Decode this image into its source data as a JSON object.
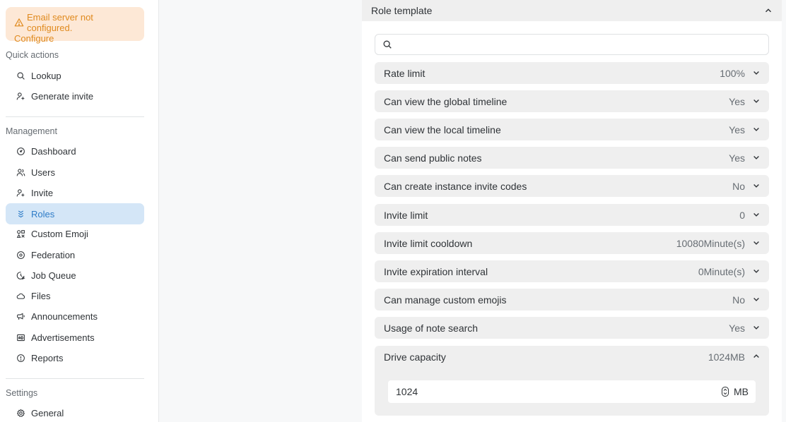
{
  "alert": {
    "message": "Email server not configured.",
    "link": "Configure"
  },
  "sidebar": {
    "quick_actions_title": "Quick actions",
    "quick_actions": [
      {
        "label": "Lookup",
        "icon": "search-icon"
      },
      {
        "label": "Generate invite",
        "icon": "user-plus-icon"
      }
    ],
    "management_title": "Management",
    "management": [
      {
        "label": "Dashboard",
        "icon": "gauge-icon"
      },
      {
        "label": "Users",
        "icon": "users-icon"
      },
      {
        "label": "Invite",
        "icon": "user-plus-icon"
      },
      {
        "label": "Roles",
        "icon": "badges-icon",
        "active": true
      },
      {
        "label": "Custom Emoji",
        "icon": "icons-icon"
      },
      {
        "label": "Federation",
        "icon": "whirl-icon"
      },
      {
        "label": "Job Queue",
        "icon": "clock-play-icon"
      },
      {
        "label": "Files",
        "icon": "cloud-icon"
      },
      {
        "label": "Announcements",
        "icon": "speakerphone-icon"
      },
      {
        "label": "Advertisements",
        "icon": "ad-icon"
      },
      {
        "label": "Reports",
        "icon": "exclamation-circle-icon"
      }
    ],
    "settings_title": "Settings",
    "settings": [
      {
        "label": "General",
        "icon": "gear-icon"
      }
    ]
  },
  "panel": {
    "title": "Role template",
    "search_placeholder": "",
    "options": [
      {
        "label": "Rate limit",
        "value": "100%"
      },
      {
        "label": "Can view the global timeline",
        "value": "Yes"
      },
      {
        "label": "Can view the local timeline",
        "value": "Yes"
      },
      {
        "label": "Can send public notes",
        "value": "Yes"
      },
      {
        "label": "Can create instance invite codes",
        "value": "No"
      },
      {
        "label": "Invite limit",
        "value": "0"
      },
      {
        "label": "Invite limit cooldown",
        "value": "10080Minute(s)"
      },
      {
        "label": "Invite expiration interval",
        "value": "0Minute(s)"
      },
      {
        "label": "Can manage custom emojis",
        "value": "No"
      },
      {
        "label": "Usage of note search",
        "value": "Yes"
      },
      {
        "label": "Drive capacity",
        "value": "1024MB",
        "expanded": true
      }
    ],
    "drive_input_value": "1024",
    "drive_unit": "MB"
  },
  "colors": {
    "accent": "#2e7cc7",
    "active_bg": "#d4e6f7",
    "warning": "#e08a1e",
    "warning_bg": "#fde8d6"
  }
}
